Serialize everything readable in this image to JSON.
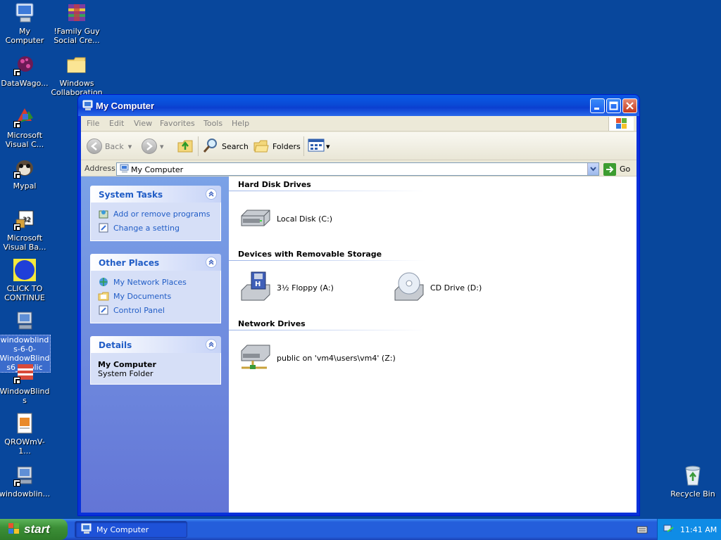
{
  "desktop": {
    "icons": [
      {
        "label": "My Computer",
        "icon": "my-computer-icon"
      },
      {
        "label": "!Family Guy Social Cre...",
        "icon": "archive-icon"
      },
      {
        "label": "DataWago...",
        "icon": "datawagon-icon"
      },
      {
        "label": "Windows Collaboration",
        "icon": "folder-icon"
      },
      {
        "label": "Microsoft Visual C...",
        "icon": "visual-studio-icon"
      },
      {
        "label": "Mypal",
        "icon": "mypal-icon"
      },
      {
        "label": "Microsoft Visual Ba...",
        "icon": "visual-basic-icon"
      },
      {
        "label": "CLICK TO CONTINUE",
        "icon": "blue-circle-icon"
      },
      {
        "label": "windowblinds-6-0-WindowBlinds6_public",
        "icon": "installer-icon"
      },
      {
        "label": "WindowBlinds",
        "icon": "windowblinds-icon"
      },
      {
        "label": "QROWmV-1...",
        "icon": "document-icon"
      },
      {
        "label": "windowblin...",
        "icon": "installer-icon"
      },
      {
        "label": "Recycle Bin",
        "icon": "recycle-bin-icon"
      }
    ]
  },
  "window": {
    "title": "My Computer",
    "menu": [
      "File",
      "Edit",
      "View",
      "Favorites",
      "Tools",
      "Help"
    ],
    "toolbar": {
      "back": "Back",
      "search": "Search",
      "folders": "Folders"
    },
    "address": {
      "label": "Address",
      "value": "My Computer",
      "go": "Go"
    },
    "tasks": {
      "system_tasks": {
        "title": "System Tasks",
        "items": [
          "Add or remove programs",
          "Change a setting"
        ]
      },
      "other_places": {
        "title": "Other Places",
        "items": [
          "My Network Places",
          "My Documents",
          "Control Panel"
        ]
      },
      "details": {
        "title": "Details",
        "name": "My Computer",
        "type": "System Folder"
      }
    },
    "groups": {
      "hard_disks": {
        "title": "Hard Disk Drives",
        "items": [
          "Local Disk (C:)"
        ]
      },
      "removable": {
        "title": "Devices with Removable Storage",
        "items": [
          "3½ Floppy (A:)",
          "CD Drive (D:)"
        ]
      },
      "network": {
        "title": "Network Drives",
        "items": [
          "public on 'vm4\\users\\vm4' (Z:)"
        ]
      }
    }
  },
  "taskbar": {
    "start": "start",
    "task": "My Computer",
    "clock": "11:41 AM"
  }
}
